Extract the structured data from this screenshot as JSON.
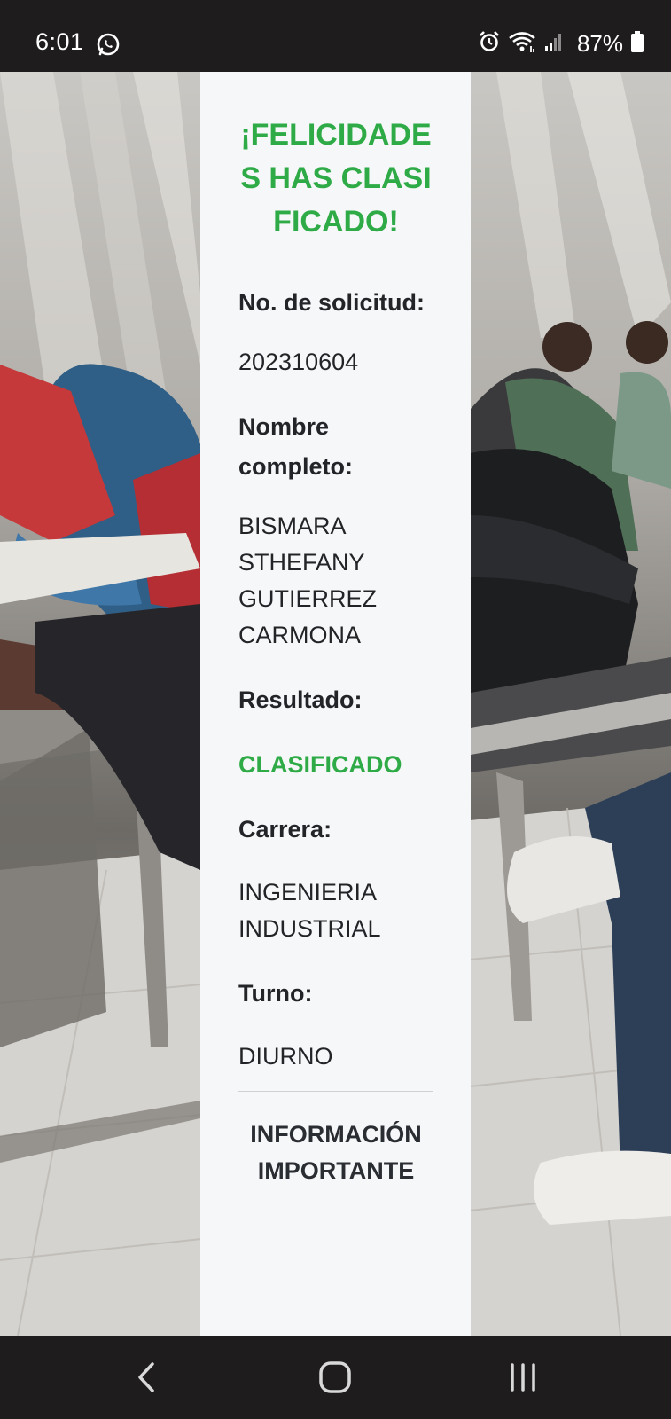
{
  "status_bar": {
    "time": "6:01",
    "battery": "87%",
    "icons": [
      "whatsapp-icon",
      "alarm-icon",
      "wifi-icon",
      "signal-icon",
      "battery-icon"
    ]
  },
  "background": {
    "description_icon": "classroom-photo"
  },
  "result_card": {
    "title": "¡FELICIDADES HAS CLASIFICADO!",
    "fields": [
      {
        "label": "No. de solicitud:",
        "value": "202310604"
      },
      {
        "label": "Nombre completo:",
        "value": "BISMARA STHEFANY GUTIERREZ CARMONA"
      },
      {
        "label": "Resultado:",
        "value": "CLASIFICADO"
      },
      {
        "label": "Carrera:",
        "value": "INGENIERIA INDUSTRIAL"
      },
      {
        "label": "Turno:",
        "value": "DIURNO"
      }
    ],
    "info_heading": "INFORMACIÓN IMPORTANTE"
  },
  "colors": {
    "accent_green": "#2eab46",
    "panel_bg": "#f6f7f9",
    "bar_bg": "#1f1c1d",
    "text_dark": "#222427"
  },
  "nav_bar": {
    "buttons": [
      "back-icon",
      "home-icon",
      "recents-icon"
    ]
  }
}
